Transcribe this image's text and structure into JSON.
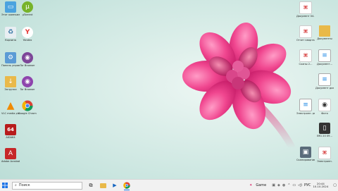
{
  "desktop": {
    "left_icons": [
      {
        "label": "Этот компьютер"
      },
      {
        "label": "µTorrent"
      },
      {
        "label": "Корзина"
      },
      {
        "label": "Yandex"
      },
      {
        "label": "Панель управления"
      },
      {
        "label": "Tor Browser"
      },
      {
        "label": "Загрузки"
      },
      {
        "label": "Tor Browser"
      },
      {
        "label": "VLC media player"
      },
      {
        "label": "Google Chrome"
      },
      {
        "label": "AIDA64"
      },
      {
        "label": "Adobe Acrobat"
      }
    ],
    "right_icons": [
      {
        "label": "Документ 04.10.2024"
      },
      {
        "label": "Отчет квартал"
      },
      {
        "label": "Документы"
      },
      {
        "label": "Сканы 2..."
      },
      {
        "label": "Документ..."
      },
      {
        "label": "Документ доклад..."
      },
      {
        "label": "Электронн. ресурсы..."
      },
      {
        "label": "Фото"
      },
      {
        "label": "IMG 20 09..."
      },
      {
        "label": "Сканирование Паспорт..."
      },
      {
        "label": "Электронн."
      }
    ]
  },
  "taskbar": {
    "search_placeholder": "Поиск",
    "game_label": "Game",
    "language": "РУС",
    "time": "20:44",
    "date": "10.10.2024"
  }
}
